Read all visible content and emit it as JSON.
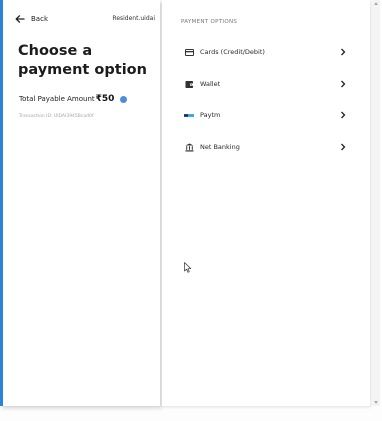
{
  "header": {
    "back_label": "Back",
    "merchant": "Resident.uidai"
  },
  "summary": {
    "title": "Choose a payment option",
    "amount_label": "Total Payable Amount",
    "amount_value": "₹50",
    "transaction_id": "Transaction ID: UIDAI3945Bcad0f"
  },
  "payment_options": {
    "section_title": "PAYMENT OPTIONS",
    "items": [
      {
        "label": "Cards (Credit/Debit)",
        "icon": "card-icon"
      },
      {
        "label": "Wallet",
        "icon": "wallet-icon"
      },
      {
        "label": "Paytm",
        "icon": "paytm-logo-icon"
      },
      {
        "label": "Net Banking",
        "icon": "bank-icon"
      }
    ]
  },
  "colors": {
    "accent": "#2b84d8",
    "info": "#4a8ed9",
    "paytm_dark": "#0b2e6e",
    "paytm_light": "#22a6e6"
  }
}
